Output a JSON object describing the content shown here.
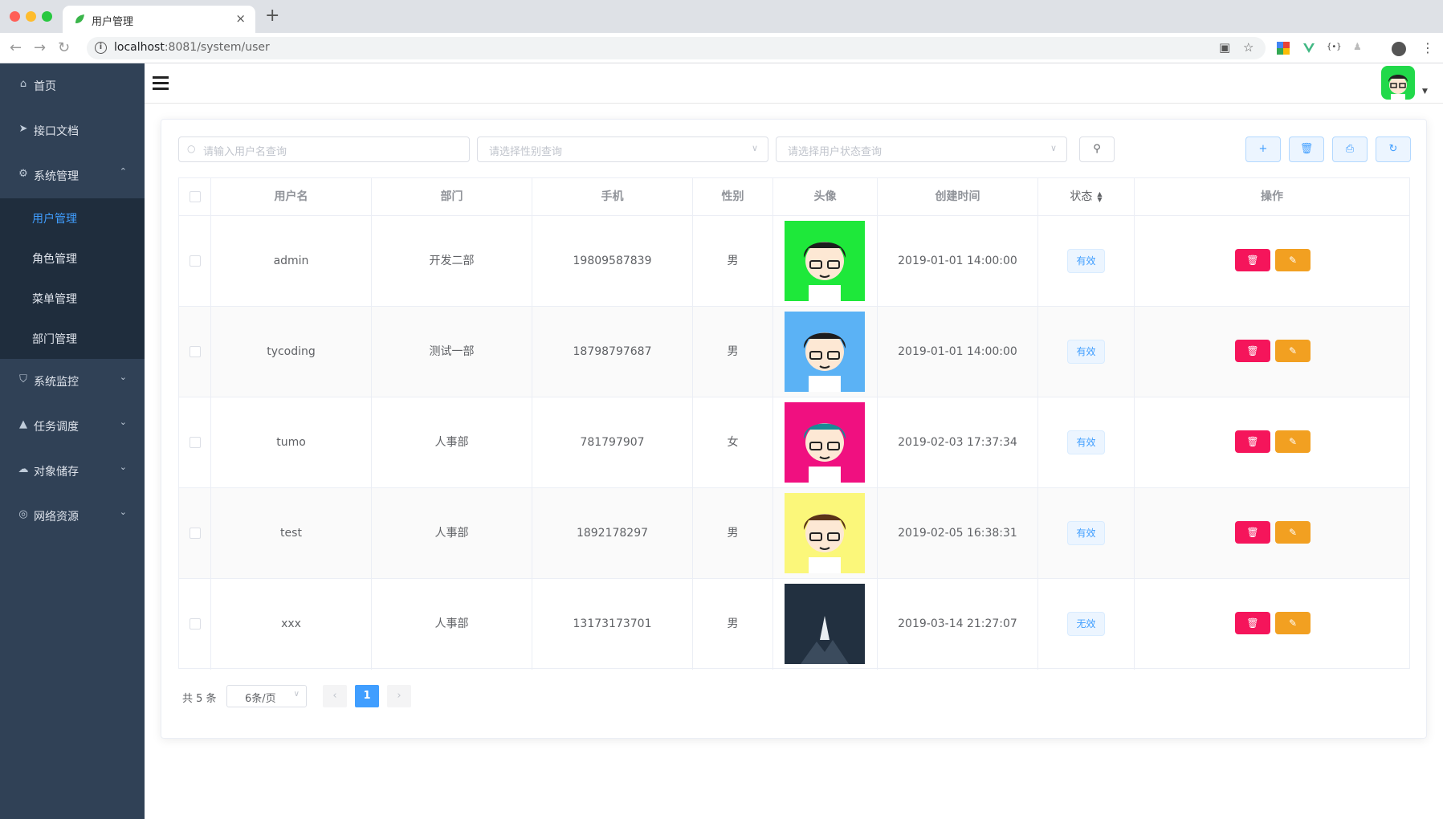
{
  "browser": {
    "tab_title": "用户管理",
    "tab_close": "×",
    "new_tab": "+",
    "url_host": "localhost",
    "url_rest": ":8081/system/user",
    "back": "←",
    "forward": "→",
    "reload": "↻"
  },
  "sidebar": {
    "items": [
      {
        "label": "首页",
        "icon": "home-icon",
        "glyph": "⌂"
      },
      {
        "label": "接口文档",
        "icon": "paper-plane-icon",
        "glyph": "➤"
      },
      {
        "label": "系统管理",
        "icon": "gear-icon",
        "glyph": "⚙",
        "arrow": "⌃"
      },
      {
        "label": "系统监控",
        "icon": "shield-icon",
        "glyph": "⛉",
        "arrow": "⌄"
      },
      {
        "label": "任务调度",
        "icon": "bell-icon",
        "glyph": "🔔",
        "arrow": "⌄"
      },
      {
        "label": "对象储存",
        "icon": "cloud-icon",
        "glyph": "☁",
        "arrow": "⌄"
      },
      {
        "label": "网络资源",
        "icon": "globe-icon",
        "glyph": "◎",
        "arrow": "⌄"
      }
    ],
    "submenu": [
      "用户管理",
      "角色管理",
      "菜单管理",
      "部门管理"
    ],
    "active_sub": "用户管理"
  },
  "filters": {
    "username_placeholder": "请输入用户名查询",
    "gender_placeholder": "请选择性别查询",
    "status_placeholder": "请选择用户状态查询"
  },
  "table": {
    "headers": [
      "用户名",
      "部门",
      "手机",
      "性别",
      "头像",
      "创建时间",
      "状态",
      "操作"
    ],
    "rows": [
      {
        "username": "admin",
        "dept": "开发二部",
        "phone": "19809587839",
        "sex": "男",
        "avatar_bg": "#1ee83a",
        "created": "2019-01-01 14:00:00",
        "status": "有效"
      },
      {
        "username": "tycoding",
        "dept": "测试一部",
        "phone": "18798797687",
        "sex": "男",
        "avatar_bg": "#5bb2f5",
        "created": "2019-01-01 14:00:00",
        "status": "有效"
      },
      {
        "username": "tumo",
        "dept": "人事部",
        "phone": "781797907",
        "sex": "女",
        "avatar_bg": "#f01080",
        "created": "2019-02-03 17:37:34",
        "status": "有效"
      },
      {
        "username": "test",
        "dept": "人事部",
        "phone": "1892178297",
        "sex": "男",
        "avatar_bg": "#fbf77a",
        "created": "2019-02-05 16:38:31",
        "status": "有效"
      },
      {
        "username": "xxx",
        "dept": "人事部",
        "phone": "13173173701",
        "sex": "男",
        "avatar_bg": "#223040",
        "created": "2019-03-14 21:27:07",
        "status": "无效"
      }
    ]
  },
  "pagination": {
    "total": "共 5 条",
    "page_size": "6条/页",
    "current_page": "1",
    "prev": "‹",
    "next": "›"
  },
  "colors": {
    "sidebar_bg": "#304156",
    "submenu_bg": "#1f2d3d",
    "accent": "#409eff",
    "delete": "#f5155b",
    "edit": "#f2a021"
  }
}
